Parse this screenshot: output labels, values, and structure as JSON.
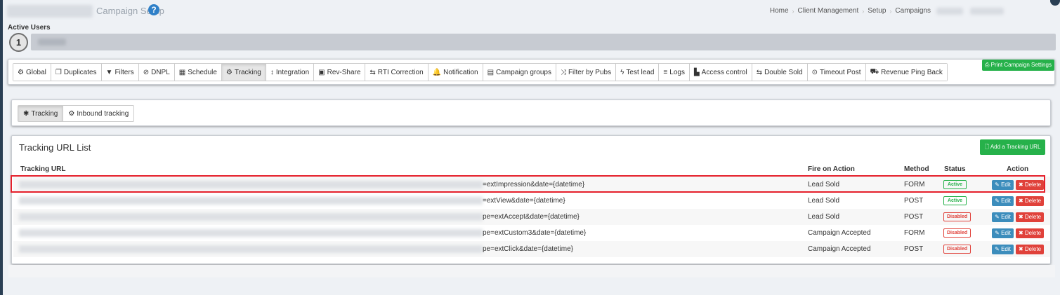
{
  "header": {
    "page_title": "Campaign Setup",
    "help_icon": "question-circle-icon",
    "breadcrumb": [
      "Home",
      "Client Management",
      "Setup",
      "Campaigns"
    ]
  },
  "active_users": {
    "label": "Active Users",
    "count": "1"
  },
  "nav_tabs": [
    {
      "label": "Global",
      "icon": "⚙"
    },
    {
      "label": "Duplicates",
      "icon": "❐"
    },
    {
      "label": "Filters",
      "icon": "▼"
    },
    {
      "label": "DNPL",
      "icon": "⊘"
    },
    {
      "label": "Schedule",
      "icon": "▦"
    },
    {
      "label": "Tracking",
      "icon": "⚙",
      "active": true
    },
    {
      "label": "Integration",
      "icon": "↕"
    },
    {
      "label": "Rev-Share",
      "icon": "▣"
    },
    {
      "label": "RTI Correction",
      "icon": "⇆"
    },
    {
      "label": "Notification",
      "icon": "🔔"
    },
    {
      "label": "Campaign groups",
      "icon": "▤"
    },
    {
      "label": "Filter by Pubs",
      "icon": "⤨"
    },
    {
      "label": "Test lead",
      "icon": "ϟ"
    },
    {
      "label": "Logs",
      "icon": "≡"
    },
    {
      "label": "Access control",
      "icon": "▙"
    },
    {
      "label": "Double Sold",
      "icon": "⇆"
    },
    {
      "label": "Timeout Post",
      "icon": "⊙"
    },
    {
      "label": "Revenue Ping Back",
      "icon": "⛟"
    }
  ],
  "print_button": "Print Campaign Settings",
  "sub_tabs": [
    {
      "label": "Tracking",
      "icon": "✱",
      "active": true
    },
    {
      "label": "Inbound tracking",
      "icon": "⚙"
    }
  ],
  "list": {
    "title": "Tracking URL List",
    "add_button": "Add a Tracking URL",
    "headers": {
      "url": "Tracking URL",
      "fire": "Fire on Action",
      "method": "Method",
      "status": "Status",
      "action": "Action"
    },
    "edit_label": "Edit",
    "delete_label": "Delete",
    "rows": [
      {
        "url_tail": "=extImpression&date={datetime}",
        "fire": "Lead Sold",
        "method": "FORM",
        "status": "Active"
      },
      {
        "url_tail": "=extView&date={datetime}",
        "fire": "Lead Sold",
        "method": "POST",
        "status": "Active"
      },
      {
        "url_tail": "pe=extAccept&date={datetime}",
        "fire": "Lead Sold",
        "method": "POST",
        "status": "Disabled"
      },
      {
        "url_tail": "pe=extCustom3&date={datetime}",
        "fire": "Campaign Accepted",
        "method": "FORM",
        "status": "Disabled"
      },
      {
        "url_tail": "pe=extClick&date={datetime}",
        "fire": "Campaign Accepted",
        "method": "POST",
        "status": "Disabled"
      }
    ]
  },
  "colors": {
    "green": "#26b14a",
    "blue": "#3c8dbc",
    "red": "#e0413a",
    "highlight": "#e5202b"
  }
}
